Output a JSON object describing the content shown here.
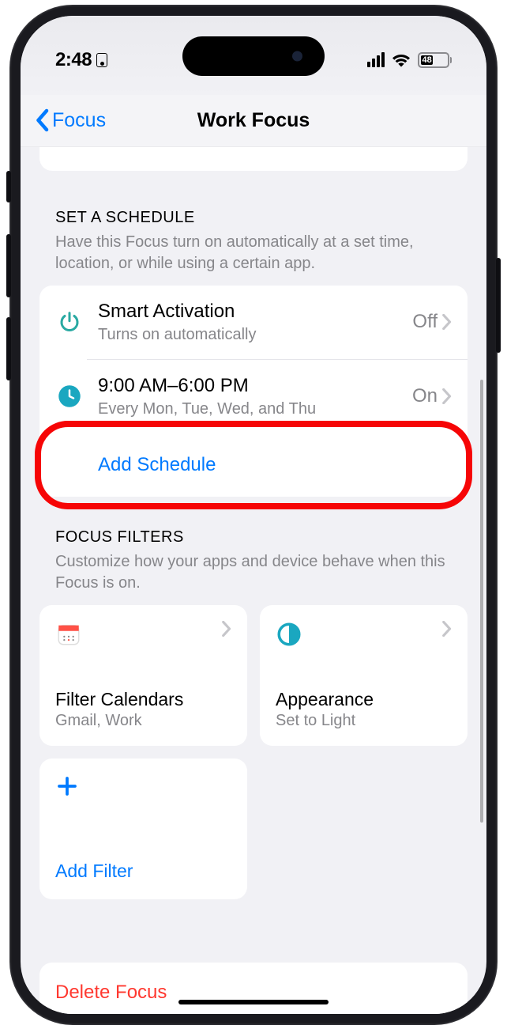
{
  "status": {
    "time": "2:48",
    "battery": "48"
  },
  "nav": {
    "back": "Focus",
    "title": "Work Focus"
  },
  "schedule": {
    "header": "SET A SCHEDULE",
    "desc": "Have this Focus turn on automatically at a set time, location, or while using a certain app.",
    "smart": {
      "title": "Smart Activation",
      "sub": "Turns on automatically",
      "value": "Off"
    },
    "time": {
      "title": "9:00 AM–6:00 PM",
      "sub": "Every Mon, Tue, Wed, and Thu",
      "value": "On"
    },
    "add": "Add Schedule"
  },
  "filters": {
    "header": "FOCUS FILTERS",
    "desc": "Customize how your apps and device behave when this Focus is on.",
    "calendar": {
      "title": "Filter Calendars",
      "sub": "Gmail, Work"
    },
    "appearance": {
      "title": "Appearance",
      "sub": "Set to Light"
    },
    "add": "Add Filter"
  },
  "delete": "Delete Focus"
}
